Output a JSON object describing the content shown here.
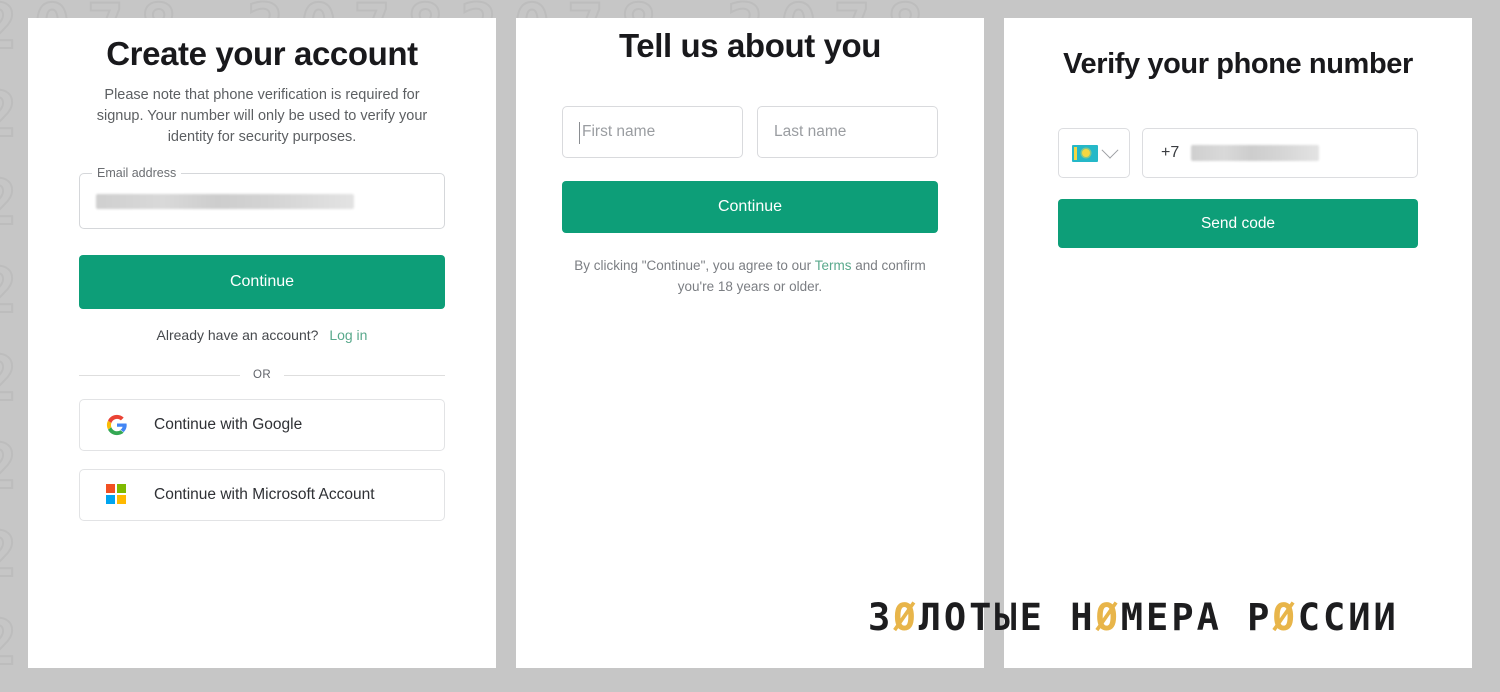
{
  "background": {
    "color": "#c6c6c6",
    "pattern_text": "2078 20782078 2078"
  },
  "panels": {
    "create_account": {
      "title": "Create your account",
      "subtitle": "Please note that phone verification is required for signup. Your number will only be used to verify your identity for security purposes.",
      "email_label": "Email address",
      "email_value": "",
      "continue_label": "Continue",
      "already_have_account": "Already have an account?",
      "login_label": "Log in",
      "or_label": "OR",
      "google_label": "Continue with Google",
      "microsoft_label": "Continue with Microsoft Account",
      "google_icon": "google-g-icon",
      "microsoft_icon": "microsoft-squares-icon"
    },
    "about_you": {
      "title": "Tell us about you",
      "first_name_placeholder": "First name",
      "first_name_value": "",
      "last_name_placeholder": "Last name",
      "last_name_value": "",
      "continue_label": "Continue",
      "terms_prefix": "By clicking \"Continue\", you agree to our",
      "terms_link": "Terms",
      "terms_suffix": "and confirm you're 18 years or older."
    },
    "verify_phone": {
      "title": "Verify your phone number",
      "country_flag": "kazakhstan-flag-icon",
      "country_chevron": "chevron-down-icon",
      "phone_prefix": "+7",
      "phone_value": "",
      "send_code_label": "Send code"
    }
  },
  "watermark": {
    "part1": "З",
    "zero1": "Ø",
    "part2": "ЛОТЫЕ Н",
    "zero2": "Ø",
    "part3": "МЕРА Р",
    "zero3": "Ø",
    "part4": "ССИИ"
  },
  "colors": {
    "accent_green": "#0d9e78",
    "link_green": "#59a98c",
    "watermark_gold": "#e8b54a",
    "flag_cyan": "#25b8c8"
  }
}
